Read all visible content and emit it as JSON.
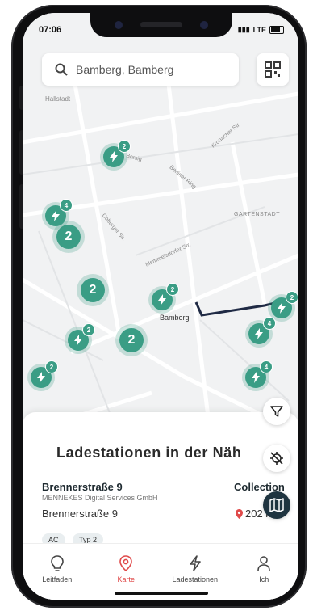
{
  "status": {
    "time": "07:06",
    "network": "LTE"
  },
  "search": {
    "value": "Bamberg, Bamberg"
  },
  "map": {
    "labels": [
      "Hallstadt",
      "GARTENSTADT",
      "Bamberg"
    ],
    "streets": [
      "Memmelsdorfer Str.",
      "Coburger Str.",
      "Kronacher Str.",
      "Borsig",
      "Berliner Ring"
    ],
    "clusters": [
      "2",
      "2",
      "2"
    ],
    "pin_badges": [
      "2",
      "4",
      "2",
      "2",
      "2",
      "2",
      "4",
      "4"
    ]
  },
  "sheet": {
    "title": "Ladestationen in der Näh",
    "station": {
      "name": "Brennerstraße 9",
      "operator": "MENNEKES Digital Services GmbH",
      "address": "Brennerstraße 9",
      "type": "Collection",
      "distance": "202 km"
    },
    "chips": [
      "AC",
      "Typ 2"
    ]
  },
  "tabs": [
    {
      "label": "Leitfaden",
      "icon": "lightbulb-icon"
    },
    {
      "label": "Karte",
      "icon": "map-pin-icon"
    },
    {
      "label": "Ladestationen",
      "icon": "lightning-icon"
    },
    {
      "label": "Ich",
      "icon": "person-icon"
    }
  ],
  "colors": {
    "accent": "#3a9d85",
    "active_tab": "#e04a4a",
    "fab_dark": "#1f3440"
  }
}
